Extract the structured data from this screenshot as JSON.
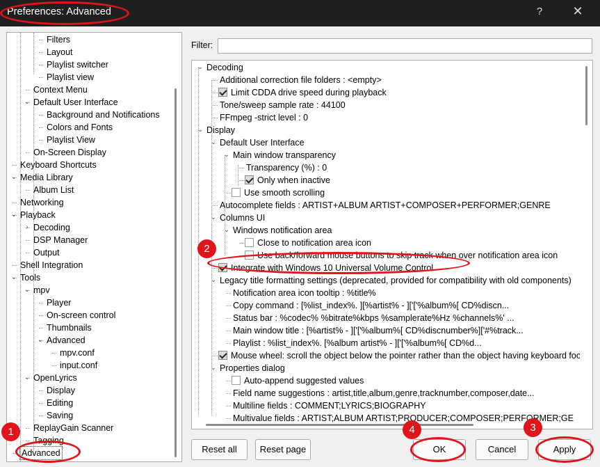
{
  "window": {
    "title": "Preferences: Advanced",
    "help": "?",
    "close": "✕"
  },
  "left_tree": [
    {
      "label": "Filters",
      "indent": 3
    },
    {
      "label": "Layout",
      "indent": 3
    },
    {
      "label": "Playlist switcher",
      "indent": 3
    },
    {
      "label": "Playlist view",
      "indent": 3
    },
    {
      "label": "Context Menu",
      "indent": 2
    },
    {
      "label": "Default User Interface",
      "indent": 2,
      "chevron": "v"
    },
    {
      "label": "Background and Notifications",
      "indent": 3
    },
    {
      "label": "Colors and Fonts",
      "indent": 3
    },
    {
      "label": "Playlist View",
      "indent": 3
    },
    {
      "label": "On-Screen Display",
      "indent": 2
    },
    {
      "label": "Keyboard Shortcuts",
      "indent": 1
    },
    {
      "label": "Media Library",
      "indent": 1,
      "chevron": "v"
    },
    {
      "label": "Album List",
      "indent": 2
    },
    {
      "label": "Networking",
      "indent": 1
    },
    {
      "label": "Playback",
      "indent": 1,
      "chevron": "v"
    },
    {
      "label": "Decoding",
      "indent": 2,
      "chevron": ">"
    },
    {
      "label": "DSP Manager",
      "indent": 2
    },
    {
      "label": "Output",
      "indent": 2
    },
    {
      "label": "Shell Integration",
      "indent": 1
    },
    {
      "label": "Tools",
      "indent": 1,
      "chevron": "v"
    },
    {
      "label": "mpv",
      "indent": 2,
      "chevron": "v"
    },
    {
      "label": "Player",
      "indent": 3
    },
    {
      "label": "On-screen control",
      "indent": 3
    },
    {
      "label": "Thumbnails",
      "indent": 3
    },
    {
      "label": "Advanced",
      "indent": 3,
      "chevron": "v"
    },
    {
      "label": "mpv.conf",
      "indent": 4
    },
    {
      "label": "input.conf",
      "indent": 4
    },
    {
      "label": "OpenLyrics",
      "indent": 2,
      "chevron": "v"
    },
    {
      "label": "Display",
      "indent": 3
    },
    {
      "label": "Editing",
      "indent": 3
    },
    {
      "label": "Saving",
      "indent": 3
    },
    {
      "label": "ReplayGain Scanner",
      "indent": 2
    },
    {
      "label": "Tagging",
      "indent": 2
    },
    {
      "label": "Advanced",
      "indent": 1,
      "selected": true
    }
  ],
  "filter": {
    "label": "Filter:",
    "value": ""
  },
  "right_tree": [
    {
      "label": "Decoding",
      "indent": 0,
      "chevron": "v"
    },
    {
      "label": "Additional correction file folders : <empty>",
      "indent": 1
    },
    {
      "label": "Limit CDDA drive speed during playback",
      "indent": 1,
      "checkbox": "on"
    },
    {
      "label": "Tone/sweep sample rate : 44100",
      "indent": 1
    },
    {
      "label": "FFmpeg -strict level : 0",
      "indent": 1
    },
    {
      "label": "Display",
      "indent": 0,
      "chevron": "v"
    },
    {
      "label": "Default User Interface",
      "indent": 1,
      "chevron": "v"
    },
    {
      "label": "Main window transparency",
      "indent": 2,
      "chevron": "v"
    },
    {
      "label": "Transparency (%) : 0",
      "indent": 3
    },
    {
      "label": "Only when inactive",
      "indent": 3,
      "checkbox": "on"
    },
    {
      "label": "Use smooth scrolling",
      "indent": 2,
      "checkbox": "off"
    },
    {
      "label": "Autocomplete fields : ARTIST+ALBUM ARTIST+COMPOSER+PERFORMER;GENRE",
      "indent": 1
    },
    {
      "label": "Columns UI",
      "indent": 1,
      "chevron": "v"
    },
    {
      "label": "Windows notification area",
      "indent": 2,
      "chevron": "v"
    },
    {
      "label": "Close to notification area icon",
      "indent": 3,
      "checkbox": "off"
    },
    {
      "label": "Use back/forward mouse buttons to skip track when over notification area icon",
      "indent": 3,
      "checkbox": "off"
    },
    {
      "label": "Integrate with Windows 10 Universal Volume Control",
      "indent": 1,
      "checkbox": "on"
    },
    {
      "label": "Legacy title formatting settings (deprecated, provided for compatibility with old components)",
      "indent": 1,
      "chevron": "v"
    },
    {
      "label": "Notification area icon tooltip : %title%",
      "indent": 2
    },
    {
      "label": "Copy command : [%list_index%. ][%artist% - ]['['%album%[ CD%discn...",
      "indent": 2
    },
    {
      "label": "Status bar : %codec% %bitrate%kbps %samplerate%Hz %channels%'  ...",
      "indent": 2
    },
    {
      "label": "Main window title : [%artist% - ]['['%album%[ CD%discnumber%]['#%track...",
      "indent": 2
    },
    {
      "label": "Playlist : %list_index%. [%album artist% - ]['['%album%[ CD%d...",
      "indent": 2
    },
    {
      "label": "Mouse wheel: scroll the object below the pointer rather than the object having keyboard focus",
      "indent": 1,
      "checkbox": "on"
    },
    {
      "label": "Properties dialog",
      "indent": 1,
      "chevron": "v"
    },
    {
      "label": "Auto-append suggested values",
      "indent": 2,
      "checkbox": "off"
    },
    {
      "label": "Field name suggestions : artist,title,album,genre,tracknumber,composer,date...",
      "indent": 2
    },
    {
      "label": "Multiline fields : COMMENT;LYRICS;BIOGRAPHY",
      "indent": 2
    },
    {
      "label": "Multivalue fields : ARTIST;ALBUM ARTIST;PRODUCER;COMPOSER;PERFORMER;GE",
      "indent": 2
    }
  ],
  "buttons": {
    "reset_all": "Reset all",
    "reset_page": "Reset page",
    "ok": "OK",
    "cancel": "Cancel",
    "apply": "Apply"
  },
  "annotations": {
    "badge1": "1",
    "badge2": "2",
    "badge3": "3",
    "badge4": "4",
    "color": "#e0141b"
  }
}
